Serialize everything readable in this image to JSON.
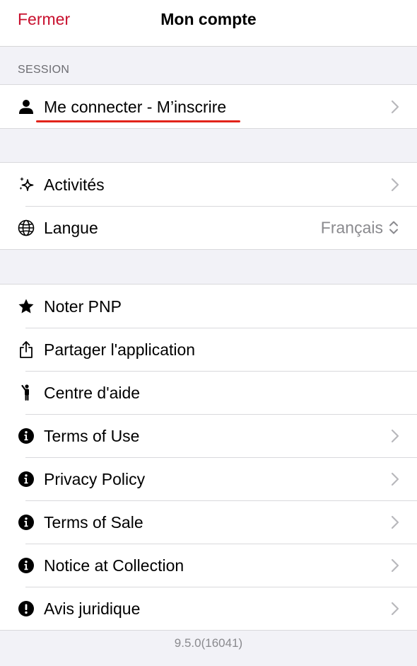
{
  "nav": {
    "close_label": "Fermer",
    "title": "Mon compte"
  },
  "session": {
    "header": "SESSION",
    "login_label": "Me connecter - M’inscrire"
  },
  "group2": {
    "activities_label": "Activités",
    "language_label": "Langue",
    "language_value": "Français"
  },
  "group3": {
    "items": [
      {
        "label": "Noter PNP",
        "icon": "star-icon"
      },
      {
        "label": "Partager l'application",
        "icon": "share-icon"
      },
      {
        "label": "Centre d'aide",
        "icon": "help-person-icon"
      },
      {
        "label": "Terms of Use",
        "icon": "info-icon"
      },
      {
        "label": "Privacy Policy",
        "icon": "info-icon"
      },
      {
        "label": "Terms of Sale",
        "icon": "info-icon"
      },
      {
        "label": "Notice at Collection",
        "icon": "info-icon"
      },
      {
        "label": "Avis juridique",
        "icon": "exclamation-icon"
      }
    ]
  },
  "footer": {
    "version": "9.5.0(16041)"
  },
  "colors": {
    "accent": "#c8102e",
    "underline": "#e2231a",
    "secondary_text": "#8a8a8e",
    "background": "#f2f2f7"
  }
}
